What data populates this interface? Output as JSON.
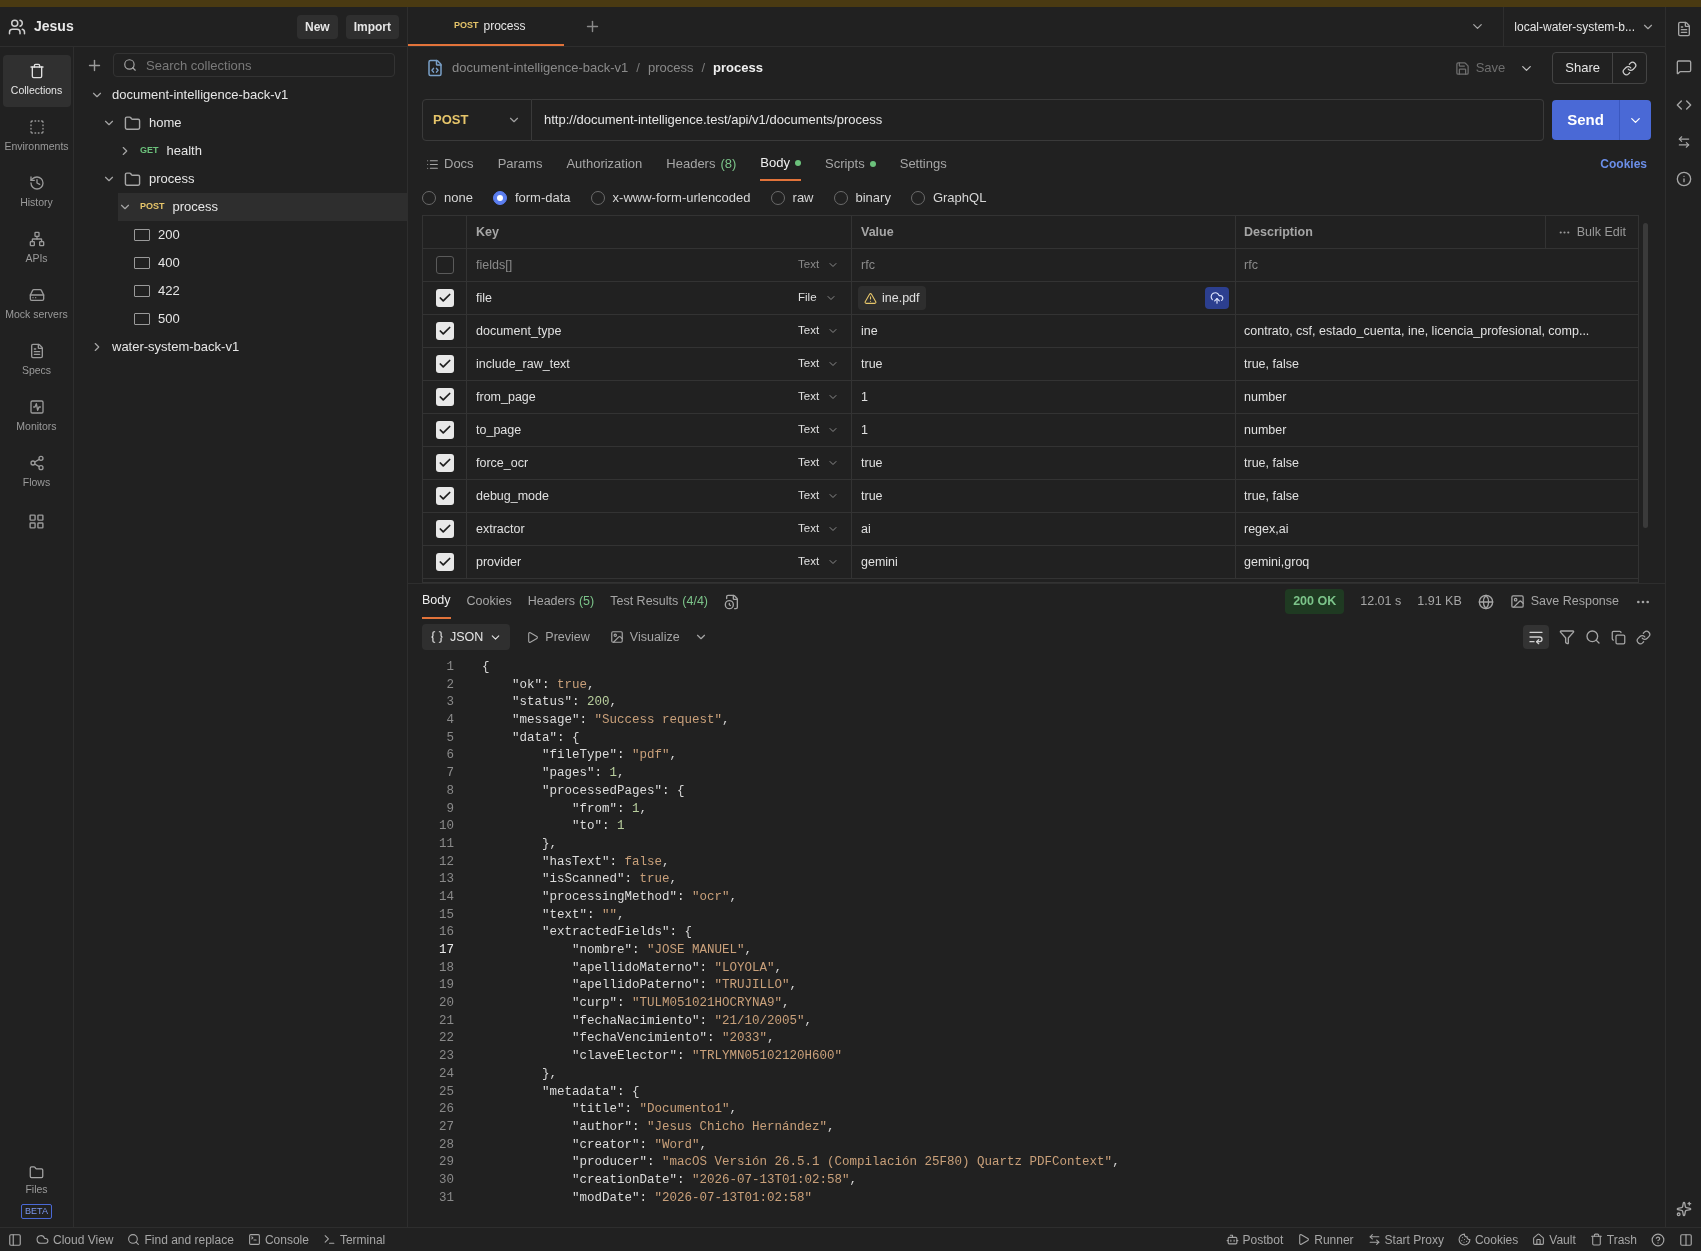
{
  "account": {
    "name": "Jesus"
  },
  "header_buttons": [
    "New",
    "Import"
  ],
  "nav": [
    {
      "label": "Collections",
      "selected": true
    },
    {
      "label": "Environments",
      "selected": false
    },
    {
      "label": "History",
      "selected": false
    },
    {
      "label": "APIs",
      "selected": false
    },
    {
      "label": "Mock servers",
      "selected": false
    },
    {
      "label": "Specs",
      "selected": false
    },
    {
      "label": "Monitors",
      "selected": false
    },
    {
      "label": "Flows",
      "selected": false
    }
  ],
  "files": {
    "label": "Files",
    "badge": "BETA"
  },
  "collections": {
    "search_placeholder": "Search collections",
    "tree": [
      {
        "label": "document-intelligence-back-v1",
        "kind": "collection",
        "expanded": true,
        "selected": false,
        "children": [
          {
            "label": "home",
            "kind": "folder",
            "expanded": true,
            "selected": false,
            "children": [
              {
                "label": "health",
                "kind": "request",
                "method": "GET",
                "expanded": false,
                "selected": false
              }
            ]
          },
          {
            "label": "process",
            "kind": "folder",
            "expanded": true,
            "selected": false,
            "children": [
              {
                "label": "process",
                "kind": "request",
                "method": "POST",
                "expanded": true,
                "selected": true,
                "children": [
                  {
                    "label": "200",
                    "kind": "example",
                    "selected": false
                  },
                  {
                    "label": "400",
                    "kind": "example",
                    "selected": false
                  },
                  {
                    "label": "422",
                    "kind": "example",
                    "selected": false
                  },
                  {
                    "label": "500",
                    "kind": "example",
                    "selected": false
                  }
                ]
              }
            ]
          }
        ]
      },
      {
        "label": "water-system-back-v1",
        "kind": "collection",
        "expanded": false,
        "selected": false
      }
    ]
  },
  "tabs": [
    {
      "method": "POST",
      "label": "process",
      "selected": true
    }
  ],
  "environment": "local-water-system-b...",
  "breadcrumb": [
    {
      "kind": "crumb",
      "label": "document-intelligence-back-v1"
    },
    {
      "kind": "separator",
      "label": "/"
    },
    {
      "kind": "crumb",
      "label": "process"
    },
    {
      "kind": "separator",
      "label": "/"
    },
    {
      "kind": "current",
      "label": "process"
    }
  ],
  "save": "Save",
  "share": "Share",
  "request": {
    "method": "POST",
    "url": "http://document-intelligence.test/api/v1/documents/process",
    "send": "Send"
  },
  "request_tabs": [
    {
      "label": "Docs",
      "selected": false,
      "dot": false
    },
    {
      "label": "Params",
      "selected": false,
      "dot": false
    },
    {
      "label": "Authorization",
      "selected": false,
      "dot": false
    },
    {
      "label": "Headers",
      "count": "(8)",
      "selected": false,
      "dot": false
    },
    {
      "label": "Body",
      "selected": true,
      "dot": true
    },
    {
      "label": "Scripts",
      "selected": false,
      "dot": true
    },
    {
      "label": "Settings",
      "selected": false,
      "dot": false
    }
  ],
  "cookies_link": "Cookies",
  "body_modes": [
    {
      "label": "none",
      "selected": false
    },
    {
      "label": "form-data",
      "selected": true
    },
    {
      "label": "x-www-form-urlencoded",
      "selected": false
    },
    {
      "label": "raw",
      "selected": false
    },
    {
      "label": "binary",
      "selected": false
    },
    {
      "label": "GraphQL",
      "selected": false
    }
  ],
  "form_table": {
    "columns": [
      "Key",
      "Value",
      "Description"
    ],
    "bulk_edit": "Bulk Edit",
    "rows": [
      {
        "kind": "text",
        "checked": false,
        "key": "fields[]",
        "type": "Text",
        "value": "rfc",
        "description": "rfc"
      },
      {
        "kind": "file",
        "checked": true,
        "key": "file",
        "type": "File",
        "value": "ine.pdf"
      },
      {
        "kind": "text",
        "checked": true,
        "key": "document_type",
        "type": "Text",
        "value": "ine",
        "description": "contrato, csf, estado_cuenta, ine, licencia_profesional, comp..."
      },
      {
        "kind": "text",
        "checked": true,
        "key": "include_raw_text",
        "type": "Text",
        "value": "true",
        "description": "true, false"
      },
      {
        "kind": "text",
        "checked": true,
        "key": "from_page",
        "type": "Text",
        "value": "1",
        "description": "number"
      },
      {
        "kind": "text",
        "checked": true,
        "key": "to_page",
        "type": "Text",
        "value": "1",
        "description": "number"
      },
      {
        "kind": "text",
        "checked": true,
        "key": "force_ocr",
        "type": "Text",
        "value": "true",
        "description": "true, false"
      },
      {
        "kind": "text",
        "checked": true,
        "key": "debug_mode",
        "type": "Text",
        "value": "true",
        "description": "true, false"
      },
      {
        "kind": "text",
        "checked": true,
        "key": "extractor",
        "type": "Text",
        "value": "ai",
        "description": "regex,ai"
      },
      {
        "kind": "text",
        "checked": true,
        "key": "provider",
        "type": "Text",
        "value": "gemini",
        "description": "gemini,groq"
      }
    ]
  },
  "response": {
    "tabs": [
      {
        "label": "Body",
        "selected": true
      },
      {
        "label": "Cookies",
        "selected": false
      },
      {
        "label": "Headers",
        "count": "(5)",
        "selected": false
      },
      {
        "label": "Test Results",
        "count": "(4/4)",
        "selected": false
      }
    ],
    "status": "200 OK",
    "time": "12.01 s",
    "size": "1.91 KB",
    "save_response": "Save Response",
    "format": "JSON",
    "preview": "Preview",
    "visualize": "Visualize",
    "lines": [
      {
        "number": "1",
        "text": "{",
        "current": false
      },
      {
        "number": "2",
        "text": "    \"ok\": true,",
        "current": false
      },
      {
        "number": "3",
        "text": "    \"status\": 200,",
        "current": false
      },
      {
        "number": "4",
        "text": "    \"message\": \"Success request\",",
        "current": false
      },
      {
        "number": "5",
        "text": "    \"data\": {",
        "current": false
      },
      {
        "number": "6",
        "text": "        \"fileType\": \"pdf\",",
        "current": false
      },
      {
        "number": "7",
        "text": "        \"pages\": 1,",
        "current": false
      },
      {
        "number": "8",
        "text": "        \"processedPages\": {",
        "current": false
      },
      {
        "number": "9",
        "text": "            \"from\": 1,",
        "current": false
      },
      {
        "number": "10",
        "text": "            \"to\": 1",
        "current": false
      },
      {
        "number": "11",
        "text": "        },",
        "current": false
      },
      {
        "number": "12",
        "text": "        \"hasText\": false,",
        "current": false
      },
      {
        "number": "13",
        "text": "        \"isScanned\": true,",
        "current": false
      },
      {
        "number": "14",
        "text": "        \"processingMethod\": \"ocr\",",
        "current": false
      },
      {
        "number": "15",
        "text": "        \"text\": \"\",",
        "current": false
      },
      {
        "number": "16",
        "text": "        \"extractedFields\": {",
        "current": false
      },
      {
        "number": "17",
        "text": "            \"nombre\": \"JOSE MANUEL\",",
        "current": true
      },
      {
        "number": "18",
        "text": "            \"apellidoMaterno\": \"LOYOLA\",",
        "current": false
      },
      {
        "number": "19",
        "text": "            \"apellidoPaterno\": \"TRUJILLO\",",
        "current": false
      },
      {
        "number": "20",
        "text": "            \"curp\": \"TULM051021HOCRYNA9\",",
        "current": false
      },
      {
        "number": "21",
        "text": "            \"fechaNacimiento\": \"21/10/2005\",",
        "current": false
      },
      {
        "number": "22",
        "text": "            \"fechaVencimiento\": \"2033\",",
        "current": false
      },
      {
        "number": "23",
        "text": "            \"claveElector\": \"TRLYMN05102120H600\"",
        "current": false
      },
      {
        "number": "24",
        "text": "        },",
        "current": false
      },
      {
        "number": "25",
        "text": "        \"metadata\": {",
        "current": false
      },
      {
        "number": "26",
        "text": "            \"title\": \"Documento1\",",
        "current": false
      },
      {
        "number": "27",
        "text": "            \"author\": \"Jesus Chicho Hernández\",",
        "current": false
      },
      {
        "number": "28",
        "text": "            \"creator\": \"Word\",",
        "current": false
      },
      {
        "number": "29",
        "text": "            \"producer\": \"macOS Versión 26.5.1 (Compilación 25F80) Quartz PDFContext\",",
        "current": false
      },
      {
        "number": "30",
        "text": "            \"creationDate\": \"2026-07-13T01:02:58\",",
        "current": false
      },
      {
        "number": "31",
        "text": "            \"modDate\": \"2026-07-13T01:02:58\"",
        "current": false
      }
    ]
  },
  "status_bar": {
    "left": [
      "Cloud View",
      "Find and replace",
      "Console",
      "Terminal"
    ],
    "right": [
      "Postbot",
      "Runner",
      "Start Proxy",
      "Cookies",
      "Vault",
      "Trash"
    ]
  }
}
